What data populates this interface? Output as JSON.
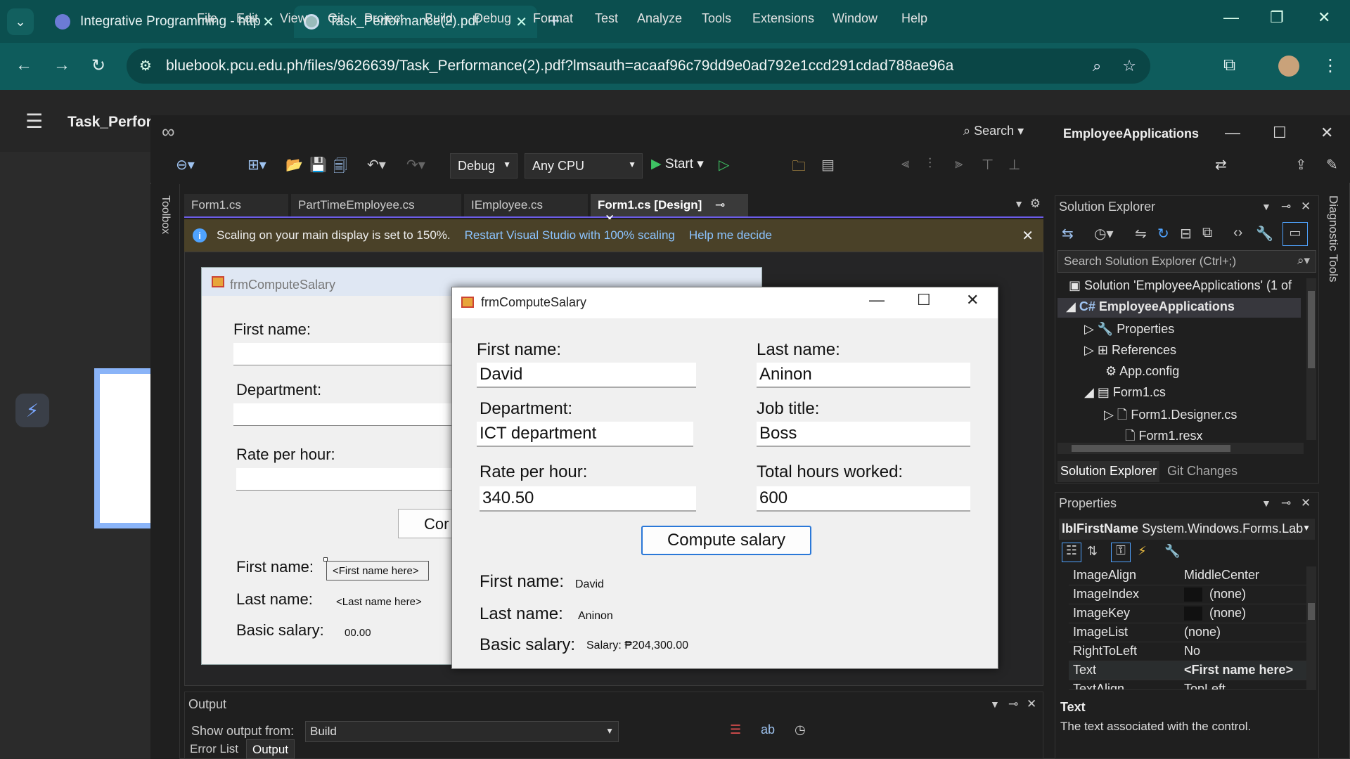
{
  "browser": {
    "tabs": [
      {
        "title": "Integrative Programming - http"
      },
      {
        "title": "Task_Performance(2).pdf"
      }
    ],
    "url": "bluebook.pcu.edu.ph/files/9626639/Task_Performance(2).pdf?lmsauth=acaaf96c79dd9e0ad792e1ccd291cdad788ae96a"
  },
  "pdf": {
    "title": "Task_Perform"
  },
  "vs": {
    "menu": [
      "File",
      "Edit",
      "View",
      "Git",
      "Project",
      "Build",
      "Debug",
      "Format",
      "Test",
      "Analyze",
      "Tools",
      "Extensions",
      "Window",
      "Help"
    ],
    "search_label": "Search",
    "app_name": "EmployeeApplications",
    "config": "Debug",
    "platform": "Any CPU",
    "start_label": "Start",
    "toolbox_label": "Toolbox",
    "diag_label": "Diagnostic Tools",
    "doc_tabs": [
      "Form1.cs",
      "PartTimeEmployee.cs",
      "IEmployee.cs",
      "Form1.cs [Design]"
    ],
    "infobar": {
      "message": "Scaling on your main display is set to 150%.",
      "link1": "Restart Visual Studio with 100% scaling",
      "link2": "Help me decide"
    }
  },
  "design_form": {
    "title": "frmComputeSalary",
    "first_name_label": "First name:",
    "department_label": "Department:",
    "rate_label": "Rate per hour:",
    "compute_btn_partial": "Cor",
    "out_first_label": "First name:",
    "out_first_value": "<First name here>",
    "out_last_label": "Last name:",
    "out_last_value": "<Last name here>",
    "out_salary_label": "Basic salary:",
    "out_salary_value": "00.00"
  },
  "run_form": {
    "title": "frmComputeSalary",
    "first_name_label": "First name:",
    "first_name_value": "David",
    "last_name_label": "Last name:",
    "last_name_value": "Aninon",
    "department_label": "Department:",
    "department_value": "ICT department",
    "job_label": "Job title:",
    "job_value": "Boss",
    "rate_label": "Rate per hour:",
    "rate_value": "340.50",
    "hours_label": "Total hours worked:",
    "hours_value": "600",
    "compute_label": "Compute salary",
    "out_first_label": "First name:",
    "out_first_value": "David",
    "out_last_label": "Last name:",
    "out_last_value": "Aninon",
    "out_salary_label": "Basic salary:",
    "out_salary_value": "Salary: ₱204,300.00"
  },
  "solution_explorer": {
    "title": "Solution Explorer",
    "search_placeholder": "Search Solution Explorer (Ctrl+;)",
    "items": [
      "Solution 'EmployeeApplications' (1 of",
      "EmployeeApplications",
      "Properties",
      "References",
      "App.config",
      "Form1.cs",
      "Form1.Designer.cs",
      "Form1.resx"
    ],
    "tabs": [
      "Solution Explorer",
      "Git Changes"
    ]
  },
  "properties": {
    "title": "Properties",
    "object_name": "lblFirstName",
    "object_type": "System.Windows.Forms.Lab",
    "rows": [
      {
        "name": "ImageAlign",
        "value": "MiddleCenter"
      },
      {
        "name": "ImageIndex",
        "value": "(none)"
      },
      {
        "name": "ImageKey",
        "value": "(none)"
      },
      {
        "name": "ImageList",
        "value": "(none)"
      },
      {
        "name": "RightToLeft",
        "value": "No"
      },
      {
        "name": "Text",
        "value": "<First name here>"
      },
      {
        "name": "TextAlign",
        "value": "TopLeft"
      }
    ],
    "desc_title": "Text",
    "desc": "The text associated with the control."
  },
  "output": {
    "title": "Output",
    "show_from_label": "Show output from:",
    "show_from_value": "Build",
    "bottom_tabs": [
      "Error List",
      "Output"
    ]
  }
}
